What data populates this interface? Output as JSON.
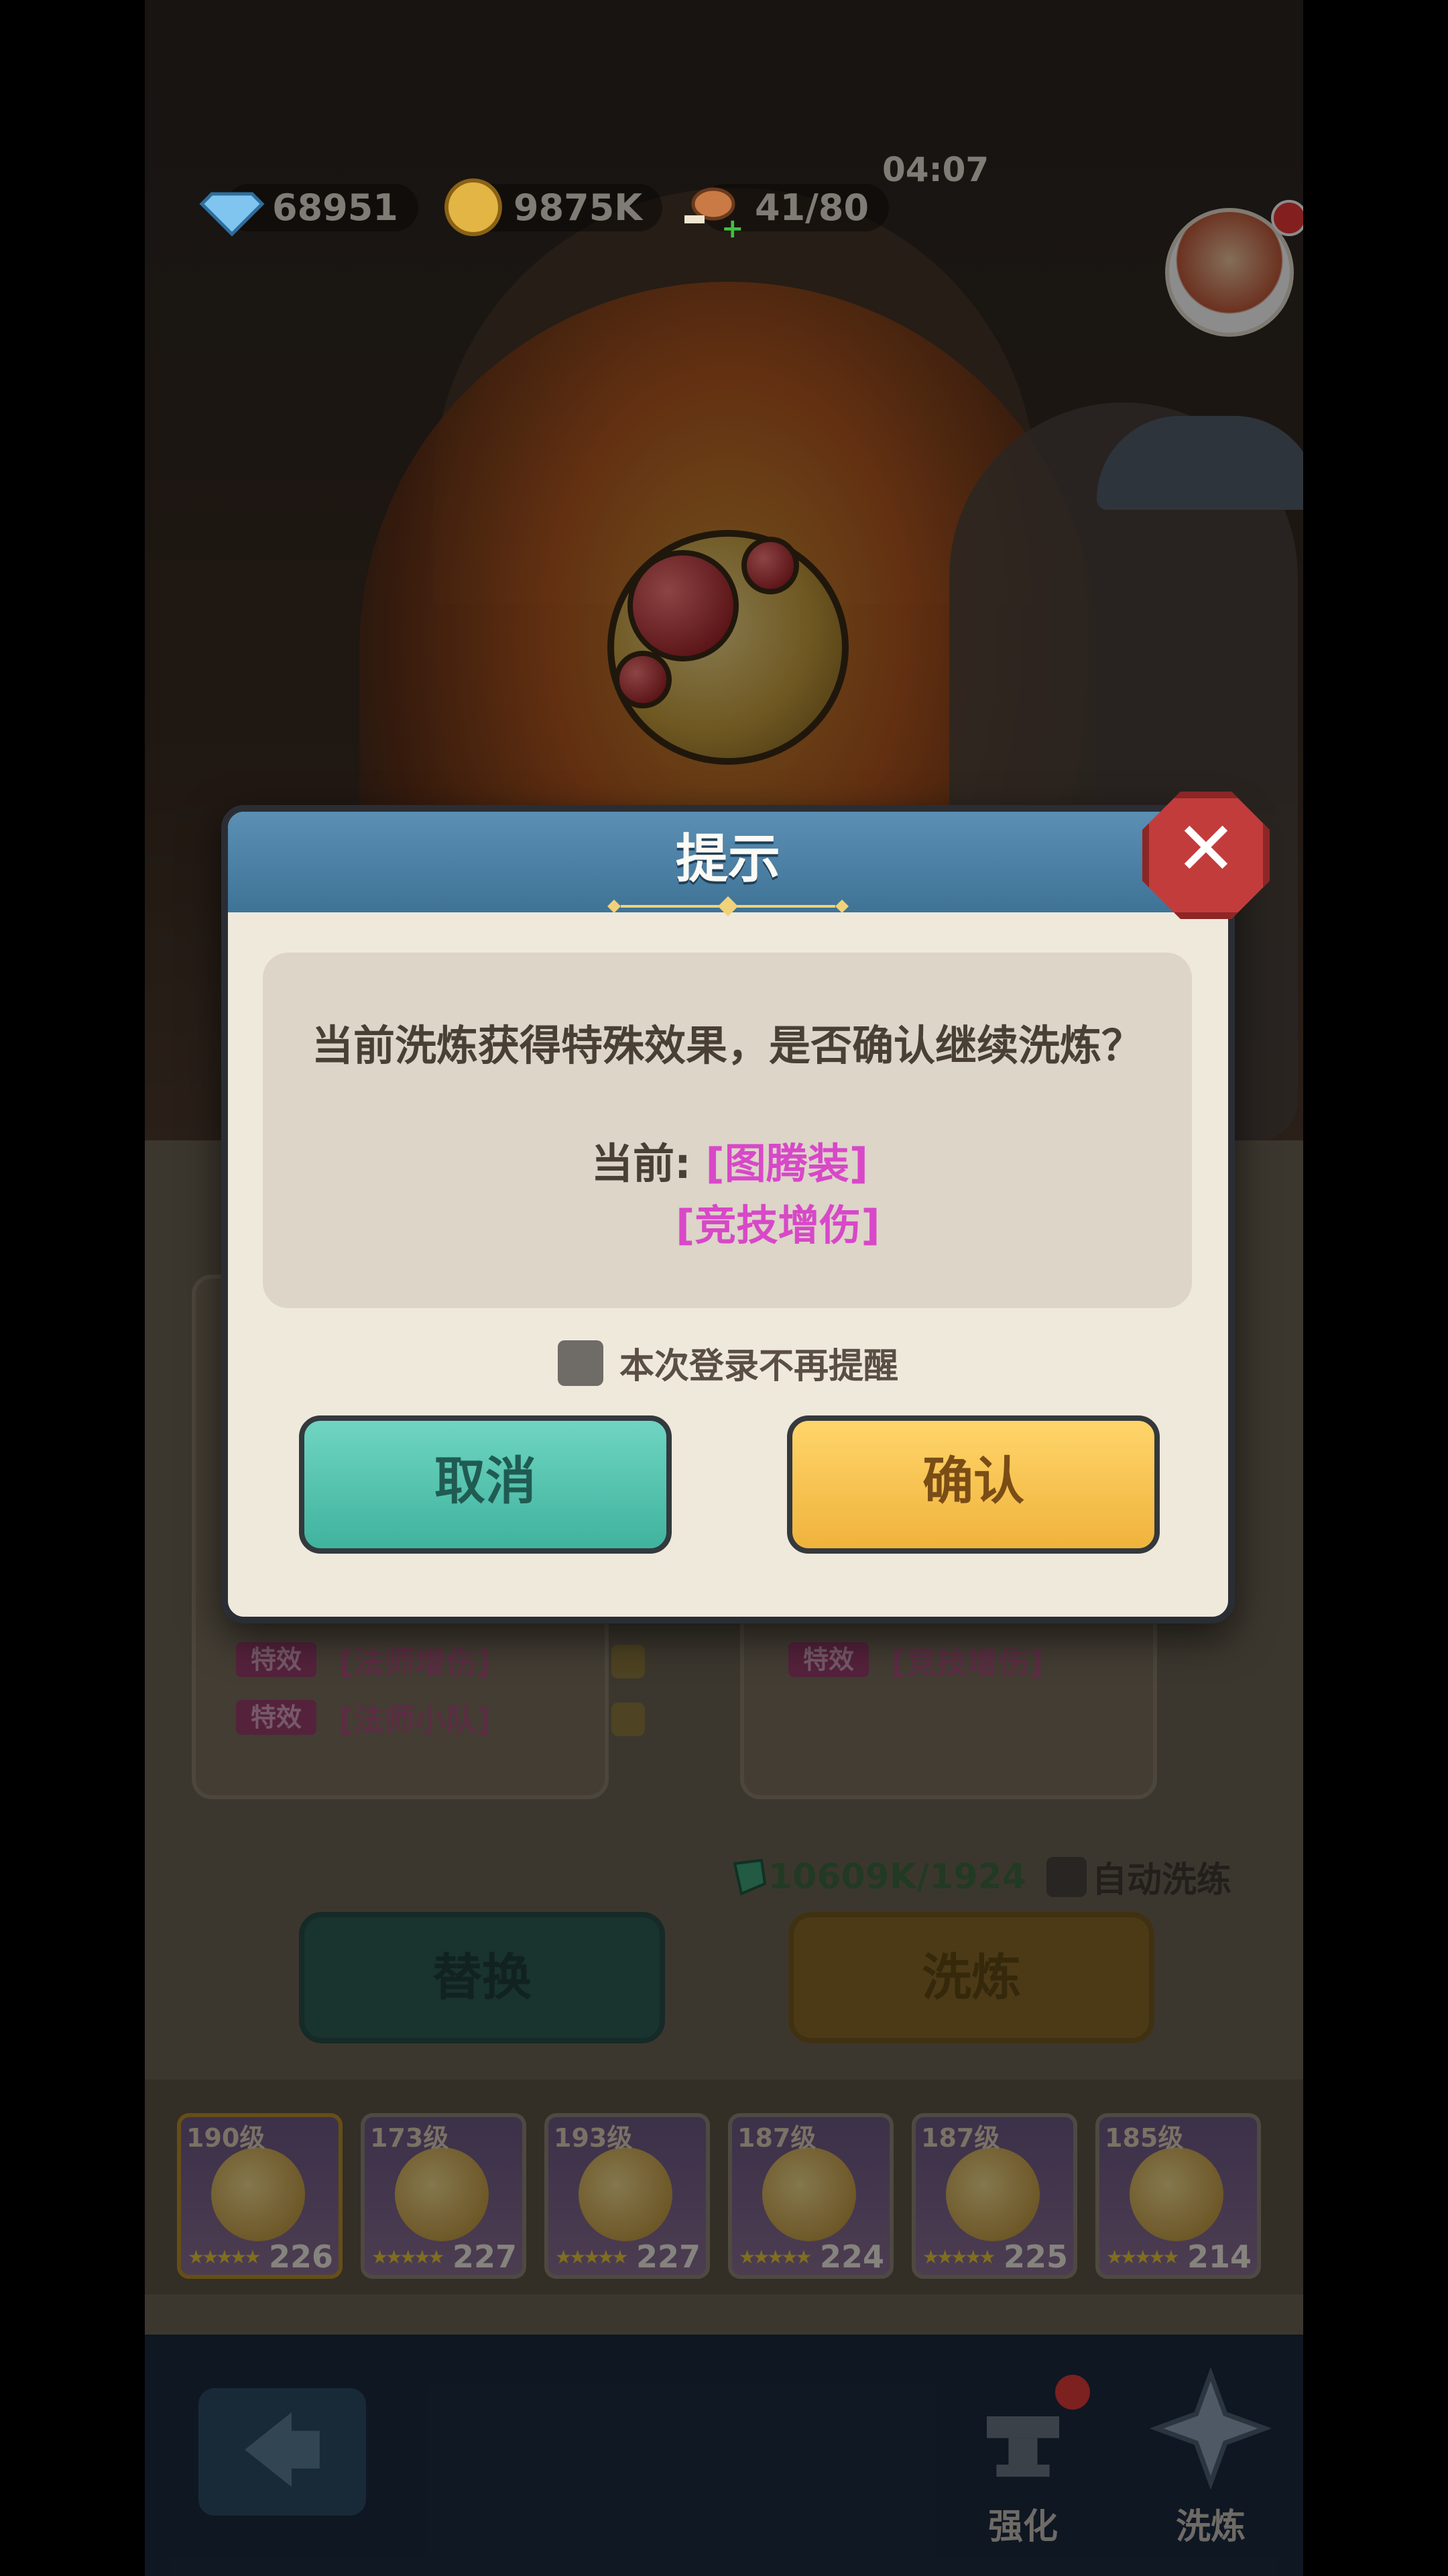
{
  "hud": {
    "gems": "68951",
    "gold": "9875K",
    "clock": "04:07",
    "stamina": "41/80"
  },
  "dialog": {
    "title": "提示",
    "message": "当前洗炼获得特殊效果，是否确认继续洗炼？",
    "current_label": "当前:",
    "current_effects": [
      "[图腾装]",
      "[竞技增伤]"
    ],
    "checkbox_label": "本次登录不再提醒",
    "cancel_label": "取消",
    "confirm_label": "确认",
    "close_symbol": "✕"
  },
  "background": {
    "left_effects": [
      {
        "tag": "特效",
        "name": "[法师增伤]"
      },
      {
        "tag": "特效",
        "name": "[法师小队]"
      }
    ],
    "right_effects": [
      {
        "tag": "特效",
        "name": "[竞技增伤]"
      }
    ],
    "cost": "10609K/1924",
    "auto_refine_label": "自动洗练",
    "replace_label": "替换",
    "refine_label": "洗炼",
    "inventory": [
      {
        "level": "190级",
        "power": "226",
        "selected": true
      },
      {
        "level": "173级",
        "power": "227",
        "selected": false
      },
      {
        "level": "193级",
        "power": "227",
        "selected": false
      },
      {
        "level": "187级",
        "power": "224",
        "selected": false
      },
      {
        "level": "187级",
        "power": "225",
        "selected": false
      },
      {
        "level": "185级",
        "power": "214",
        "selected": false
      }
    ],
    "nav": {
      "back_symbol": "🡄",
      "strengthen_label": "强化",
      "refine_label": "洗炼"
    }
  },
  "colors": {
    "effect_pink": "#d848c8",
    "cancel_teal": "#4fc4ad",
    "confirm_gold": "#f5c24a",
    "header_blue": "#4a80a5"
  }
}
